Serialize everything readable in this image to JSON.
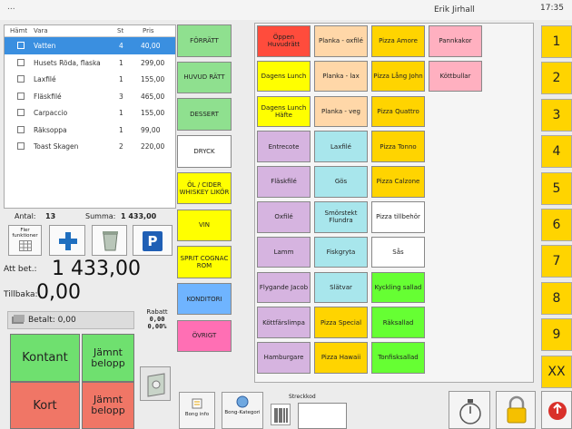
{
  "topbar": {
    "menu": "...",
    "user": "Erik Jirhall",
    "clock": "17:35"
  },
  "order": {
    "headers": {
      "hamt": "Hämt",
      "vara": "Vara",
      "st": "St",
      "pris": "Pris"
    },
    "rows": [
      {
        "name": "Vatten",
        "qty": "4",
        "price": "40,00",
        "selected": true
      },
      {
        "name": "Husets Röda, flaska",
        "qty": "1",
        "price": "299,00"
      },
      {
        "name": "Laxfilé",
        "qty": "1",
        "price": "155,00"
      },
      {
        "name": "Fläskfilé",
        "qty": "3",
        "price": "465,00"
      },
      {
        "name": "Carpaccio",
        "qty": "1",
        "price": "155,00"
      },
      {
        "name": "Räksoppa",
        "qty": "1",
        "price": "99,00"
      },
      {
        "name": "Toast Skagen",
        "qty": "2",
        "price": "220,00"
      }
    ]
  },
  "totals": {
    "antal_label": "Antal:",
    "antal": "13",
    "summa_label": "Summa:",
    "summa": "1 433,00"
  },
  "tools": {
    "fler": "Fler funktioner",
    "p_label": "P"
  },
  "payment": {
    "att_bet_label": "Att bet.:",
    "att_bet": "1 433,00",
    "tillbaka_label": "Tillbaka:",
    "tillbaka": "0,00",
    "betalt": "Betalt: 0,00",
    "rabatt_label": "Rabatt",
    "rabatt_amount": "0,00",
    "rabatt_pct": "0,00%",
    "kontant": "Kontant",
    "jamnt_belopp": "Jämnt belopp",
    "kort": "Kort"
  },
  "categories": [
    {
      "label": "FÖRRÄTT",
      "color": "#8fe08f"
    },
    {
      "label": "HUVUD RÄTT",
      "color": "#8fe08f"
    },
    {
      "label": "DESSERT",
      "color": "#8fe08f"
    },
    {
      "label": "DRYCK",
      "color": "#ffffff"
    },
    {
      "label": "ÖL / CIDER WHISKEY LIKÖR",
      "color": "#ffff00"
    },
    {
      "label": "VIN",
      "color": "#ffff00"
    },
    {
      "label": "SPRIT COGNAC ROM",
      "color": "#ffff00"
    },
    {
      "label": "KONDITORI",
      "color": "#6fb4ff"
    },
    {
      "label": "ÖVRIGT",
      "color": "#ff6fb4"
    }
  ],
  "products": [
    [
      {
        "label": "Öppen Huvudrätt",
        "color": "#ff4c3c"
      },
      {
        "label": "Planka - oxfilé",
        "color": "#ffd7a8"
      },
      {
        "label": "Pizza Amore",
        "color": "#ffd400"
      },
      {
        "label": "Pannkakor",
        "color": "#ffb0c0"
      }
    ],
    [
      {
        "label": "Dagens Lunch",
        "color": "#ffff00"
      },
      {
        "label": "Planka - lax",
        "color": "#ffd7a8"
      },
      {
        "label": "Pizza Lång John",
        "color": "#ffd400"
      },
      {
        "label": "Köttbullar",
        "color": "#ffb0c0"
      }
    ],
    [
      {
        "label": "Dagens Lunch Häfte",
        "color": "#ffff00"
      },
      {
        "label": "Planka - veg",
        "color": "#ffd7a8"
      },
      {
        "label": "Pizza Quattro",
        "color": "#ffd400"
      }
    ],
    [
      {
        "label": "Entrecote",
        "color": "#d6b4e0"
      },
      {
        "label": "Laxfilé",
        "color": "#a8e6ec"
      },
      {
        "label": "Pizza Tonno",
        "color": "#ffd400"
      }
    ],
    [
      {
        "label": "Fläskfilé",
        "color": "#d6b4e0"
      },
      {
        "label": "Gös",
        "color": "#a8e6ec"
      },
      {
        "label": "Pizza Calzone",
        "color": "#ffd400"
      }
    ],
    [
      {
        "label": "Oxfilé",
        "color": "#d6b4e0"
      },
      {
        "label": "Smörstekt Flundra",
        "color": "#a8e6ec"
      },
      {
        "label": "Pizza tillbehör",
        "color": "#ffffff"
      }
    ],
    [
      {
        "label": "Lamm",
        "color": "#d6b4e0"
      },
      {
        "label": "Fiskgryta",
        "color": "#a8e6ec"
      },
      {
        "label": "Sås",
        "color": "#ffffff"
      }
    ],
    [
      {
        "label": "Flygande Jacob",
        "color": "#d6b4e0"
      },
      {
        "label": "Slätvar",
        "color": "#a8e6ec"
      },
      {
        "label": "Kyckling sallad",
        "color": "#66ff33"
      }
    ],
    [
      {
        "label": "Köttfärslimpa",
        "color": "#d6b4e0"
      },
      {
        "label": "Pizza Special",
        "color": "#ffd400"
      },
      {
        "label": "Räksallad",
        "color": "#66ff33"
      }
    ],
    [
      {
        "label": "Hamburgare",
        "color": "#d6b4e0"
      },
      {
        "label": "Pizza Hawaii",
        "color": "#ffd400"
      },
      {
        "label": "Tonfisksallad",
        "color": "#66ff33"
      }
    ]
  ],
  "numbers": [
    "1",
    "2",
    "3",
    "4",
    "5",
    "6",
    "7",
    "8",
    "9",
    "XX"
  ],
  "bottom": {
    "bong_info": "Bong info",
    "bong_kategori": "Bong-Kategori",
    "streckkod": "Streckkod"
  }
}
